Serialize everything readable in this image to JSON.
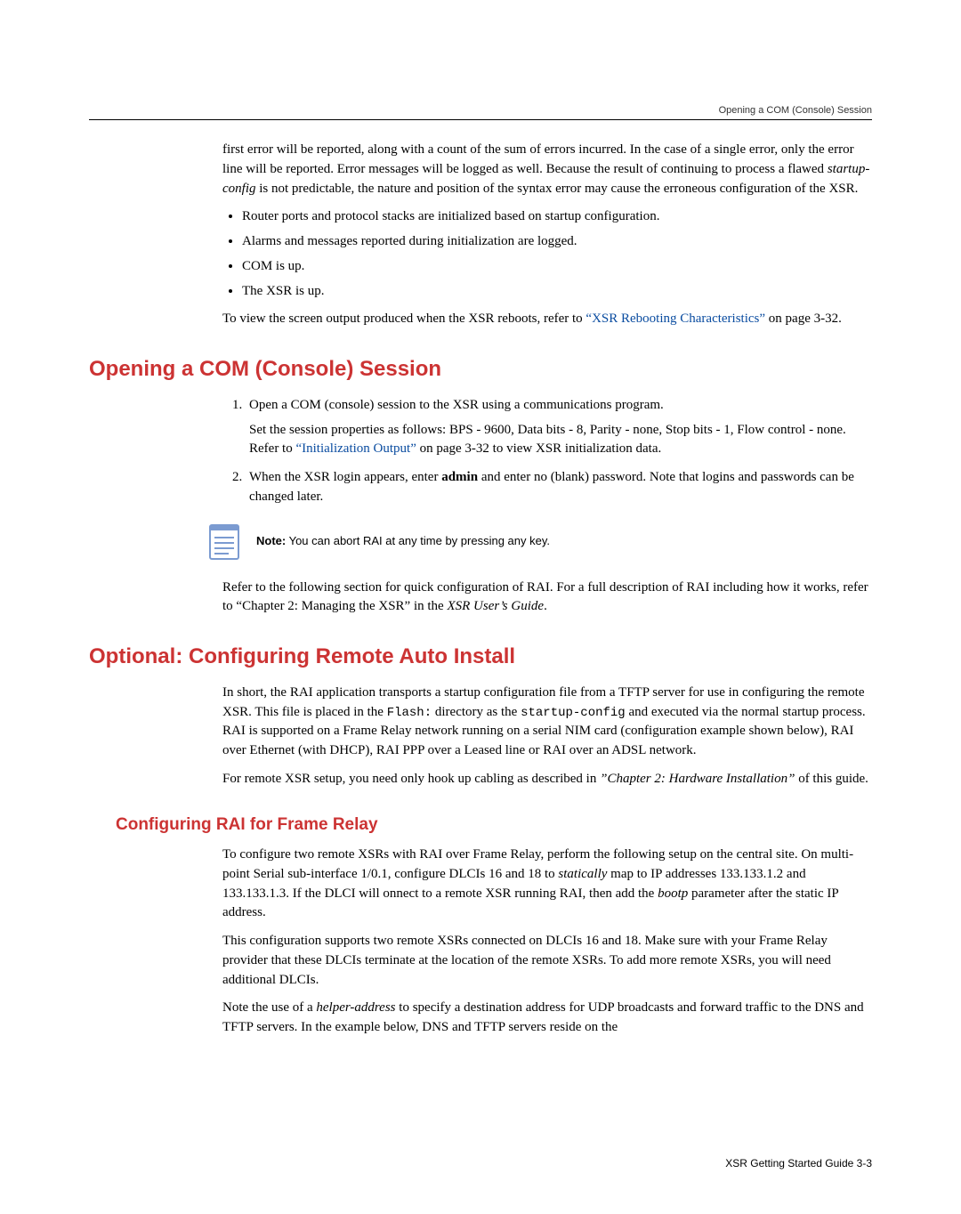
{
  "runningHead": "Opening a COM (Console) Session",
  "intro": {
    "para": "first error will be reported, along with a count of the sum of errors incurred. In the case of a single error, only the error line will be reported. Error messages will be logged as well. Because the result of continuing to process a flawed ",
    "paraItalic": "startup-config",
    "paraTail": " is not predictable, the nature and position of the syntax error may cause the erroneous configuration of the XSR.",
    "bullets": [
      "Router ports and protocol stacks are initialized based on startup configuration.",
      "Alarms and messages reported during initialization are logged.",
      "COM is up.",
      "The XSR is up."
    ],
    "closingA": "To view the screen output produced when the XSR reboots, refer to ",
    "closingLink": "“XSR Rebooting Characteristics”",
    "closingB": " on page 3-32."
  },
  "section1": {
    "title": "Opening a COM (Console) Session",
    "steps": [
      {
        "text": "Open a COM (console) session to the XSR using a communications program.",
        "subA": "Set the session properties as follows: BPS - 9600, Data bits - 8, Parity - none, Stop bits - 1, Flow control - none. Refer to ",
        "subLink": "“Initialization Output”",
        "subB": " on page 3-32 to view XSR initialization data."
      },
      {
        "pre": "When the XSR login appears, enter ",
        "bold": "admin",
        "post": " and enter no (blank) password. Note that logins and passwords can be changed later."
      }
    ],
    "noteLabel": "Note:",
    "noteText": " You can abort RAI at any time by pressing any key.",
    "afterNoteA": "Refer to the following section for quick configuration of RAI. For a full description of RAI including how it works, refer to “Chapter 2: Managing the XSR” in the ",
    "afterNoteItalic": "XSR User’s Guide",
    "afterNoteB": "."
  },
  "section2": {
    "title": "Optional: Configuring Remote Auto Install",
    "p1a": "In short, the RAI application transports a startup configuration file from a TFTP server for use in configuring the remote XSR. This file is placed in the ",
    "mono1": "Flash:",
    "p1b": " directory as the ",
    "mono2": "startup-config",
    "p1c": " and executed via the normal startup process. RAI is supported on a Frame Relay network running on a serial NIM card (configuration example shown below), RAI over Ethernet (with DHCP), RAI PPP over a Leased line or RAI over an ADSL network.",
    "p2a": "For remote XSR setup, you need only hook up cabling as described in ",
    "p2italic": "”Chapter 2: Hardware Installation”",
    "p2b": " of this guide."
  },
  "section3": {
    "title": "Configuring RAI for Frame Relay",
    "p1a": "To configure two remote XSRs  with RAI over Frame Relay, perform the following setup on the central site. On multi-point Serial sub-interface 1/0.1, configure DLCIs 16 and 18 to ",
    "p1italic": "statically",
    "p1b": " map to IP addresses 133.133.1.2 and 133.133.1.3. If the DLCI will onnect to a remote XSR running RAI, then add the ",
    "p1italic2": "bootp",
    "p1c": " parameter after the static IP address.",
    "p2": "This configuration supports two remote XSRs connected on DLCIs 16 and 18. Make sure with your Frame Relay provider that these DLCIs terminate at the location of the remote XSRs.  To add more remote XSRs, you will need additional DLCIs.",
    "p3a": "Note the use of a ",
    "p3italic": "helper-address",
    "p3b": " to specify a destination address for UDP broadcasts and forward traffic to the DNS and TFTP servers. In the example below, DNS and TFTP servers reside on the"
  },
  "footer": "XSR Getting Started Guide   3-3"
}
